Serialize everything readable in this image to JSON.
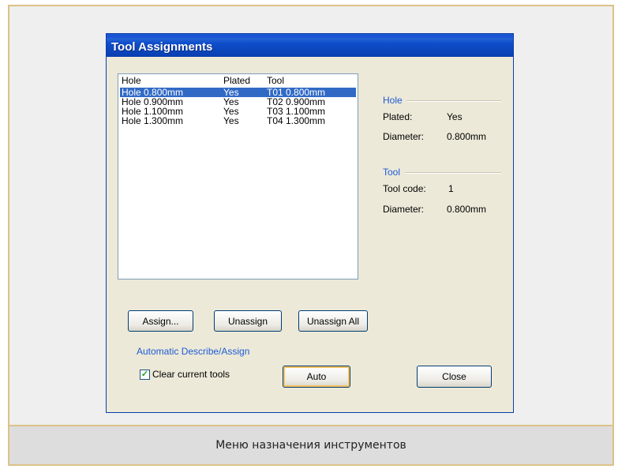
{
  "dialog": {
    "title": "Tool Assignments"
  },
  "list": {
    "columns": [
      "Hole",
      "Plated",
      "Tool"
    ],
    "rows": [
      {
        "hole": "Hole 0.800mm",
        "plated": "Yes",
        "tool": "T01 0.800mm",
        "selected": true
      },
      {
        "hole": "Hole 0.900mm",
        "plated": "Yes",
        "tool": "T02 0.900mm",
        "selected": false
      },
      {
        "hole": "Hole 1.100mm",
        "plated": "Yes",
        "tool": "T03 1.100mm",
        "selected": false
      },
      {
        "hole": "Hole 1.300mm",
        "plated": "Yes",
        "tool": "T04 1.300mm",
        "selected": false
      }
    ]
  },
  "hole_info": {
    "heading": "Hole",
    "plated_label": "Plated:",
    "plated_value": "Yes",
    "diameter_label": "Diameter:",
    "diameter_value": "0.800mm"
  },
  "tool_info": {
    "heading": "Tool",
    "code_label": "Tool code:",
    "code_value": "1",
    "diameter_label": "Diameter:",
    "diameter_value": "0.800mm"
  },
  "buttons": {
    "assign": "Assign...",
    "unassign": "Unassign",
    "unassign_all": "Unassign All",
    "auto": "Auto",
    "close": "Close"
  },
  "auto_section": {
    "heading": "Automatic Describe/Assign",
    "checkbox_label": "Clear current tools",
    "checkbox_checked": true,
    "check_glyph": "✓"
  },
  "caption": "Меню назначения инструментов",
  "colors": {
    "frame_border": "#dcc287",
    "title_bar": "#0e4ecb",
    "selection": "#316ac5",
    "group_heading": "#1e5bd6"
  }
}
